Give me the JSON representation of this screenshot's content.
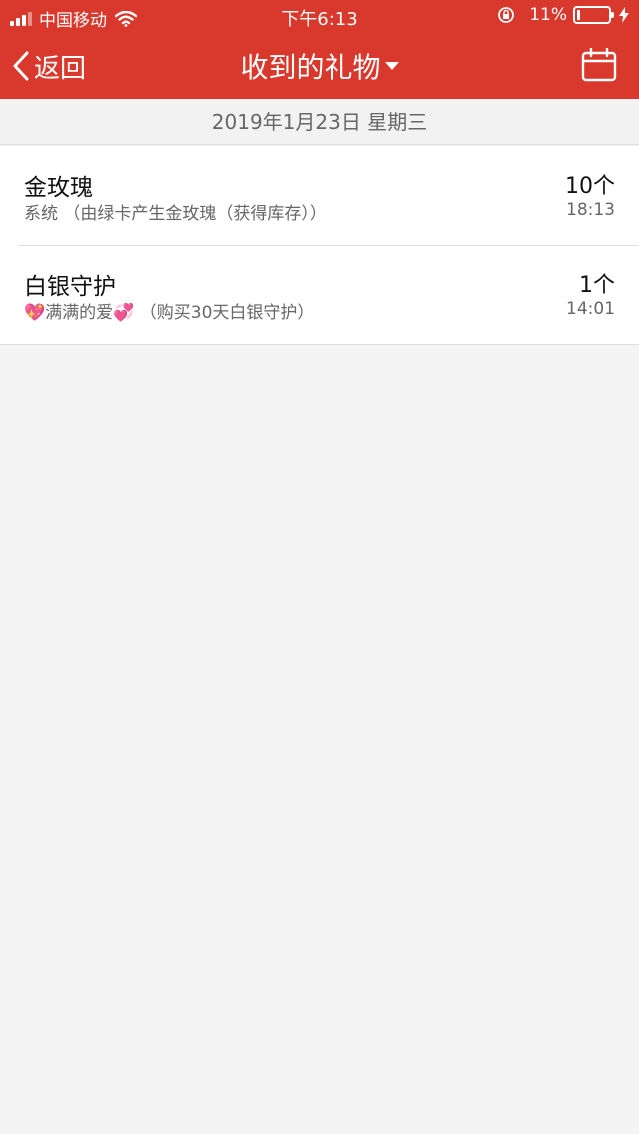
{
  "status_bar": {
    "carrier": "中国移动",
    "time": "下午6:13",
    "battery_pct": "11%",
    "battery_level": 0.11
  },
  "nav": {
    "back_label": "返回",
    "title": "收到的礼物"
  },
  "date": "2019年1月23日 星期三",
  "gifts": [
    {
      "name": "金玫瑰",
      "sender": "系统",
      "note": "（由绿卡产生金玫瑰（获得库存））",
      "count": "10个",
      "time": "18:13"
    },
    {
      "name": "白银守护",
      "emoji_left": "💖",
      "sender": "满满的爱",
      "emoji_right": "💞",
      "note": "（购买30天白银守护）",
      "count": "1个",
      "time": "14:01"
    }
  ],
  "colors": {
    "header": "#d8392c",
    "background": "#f4f4f4"
  }
}
